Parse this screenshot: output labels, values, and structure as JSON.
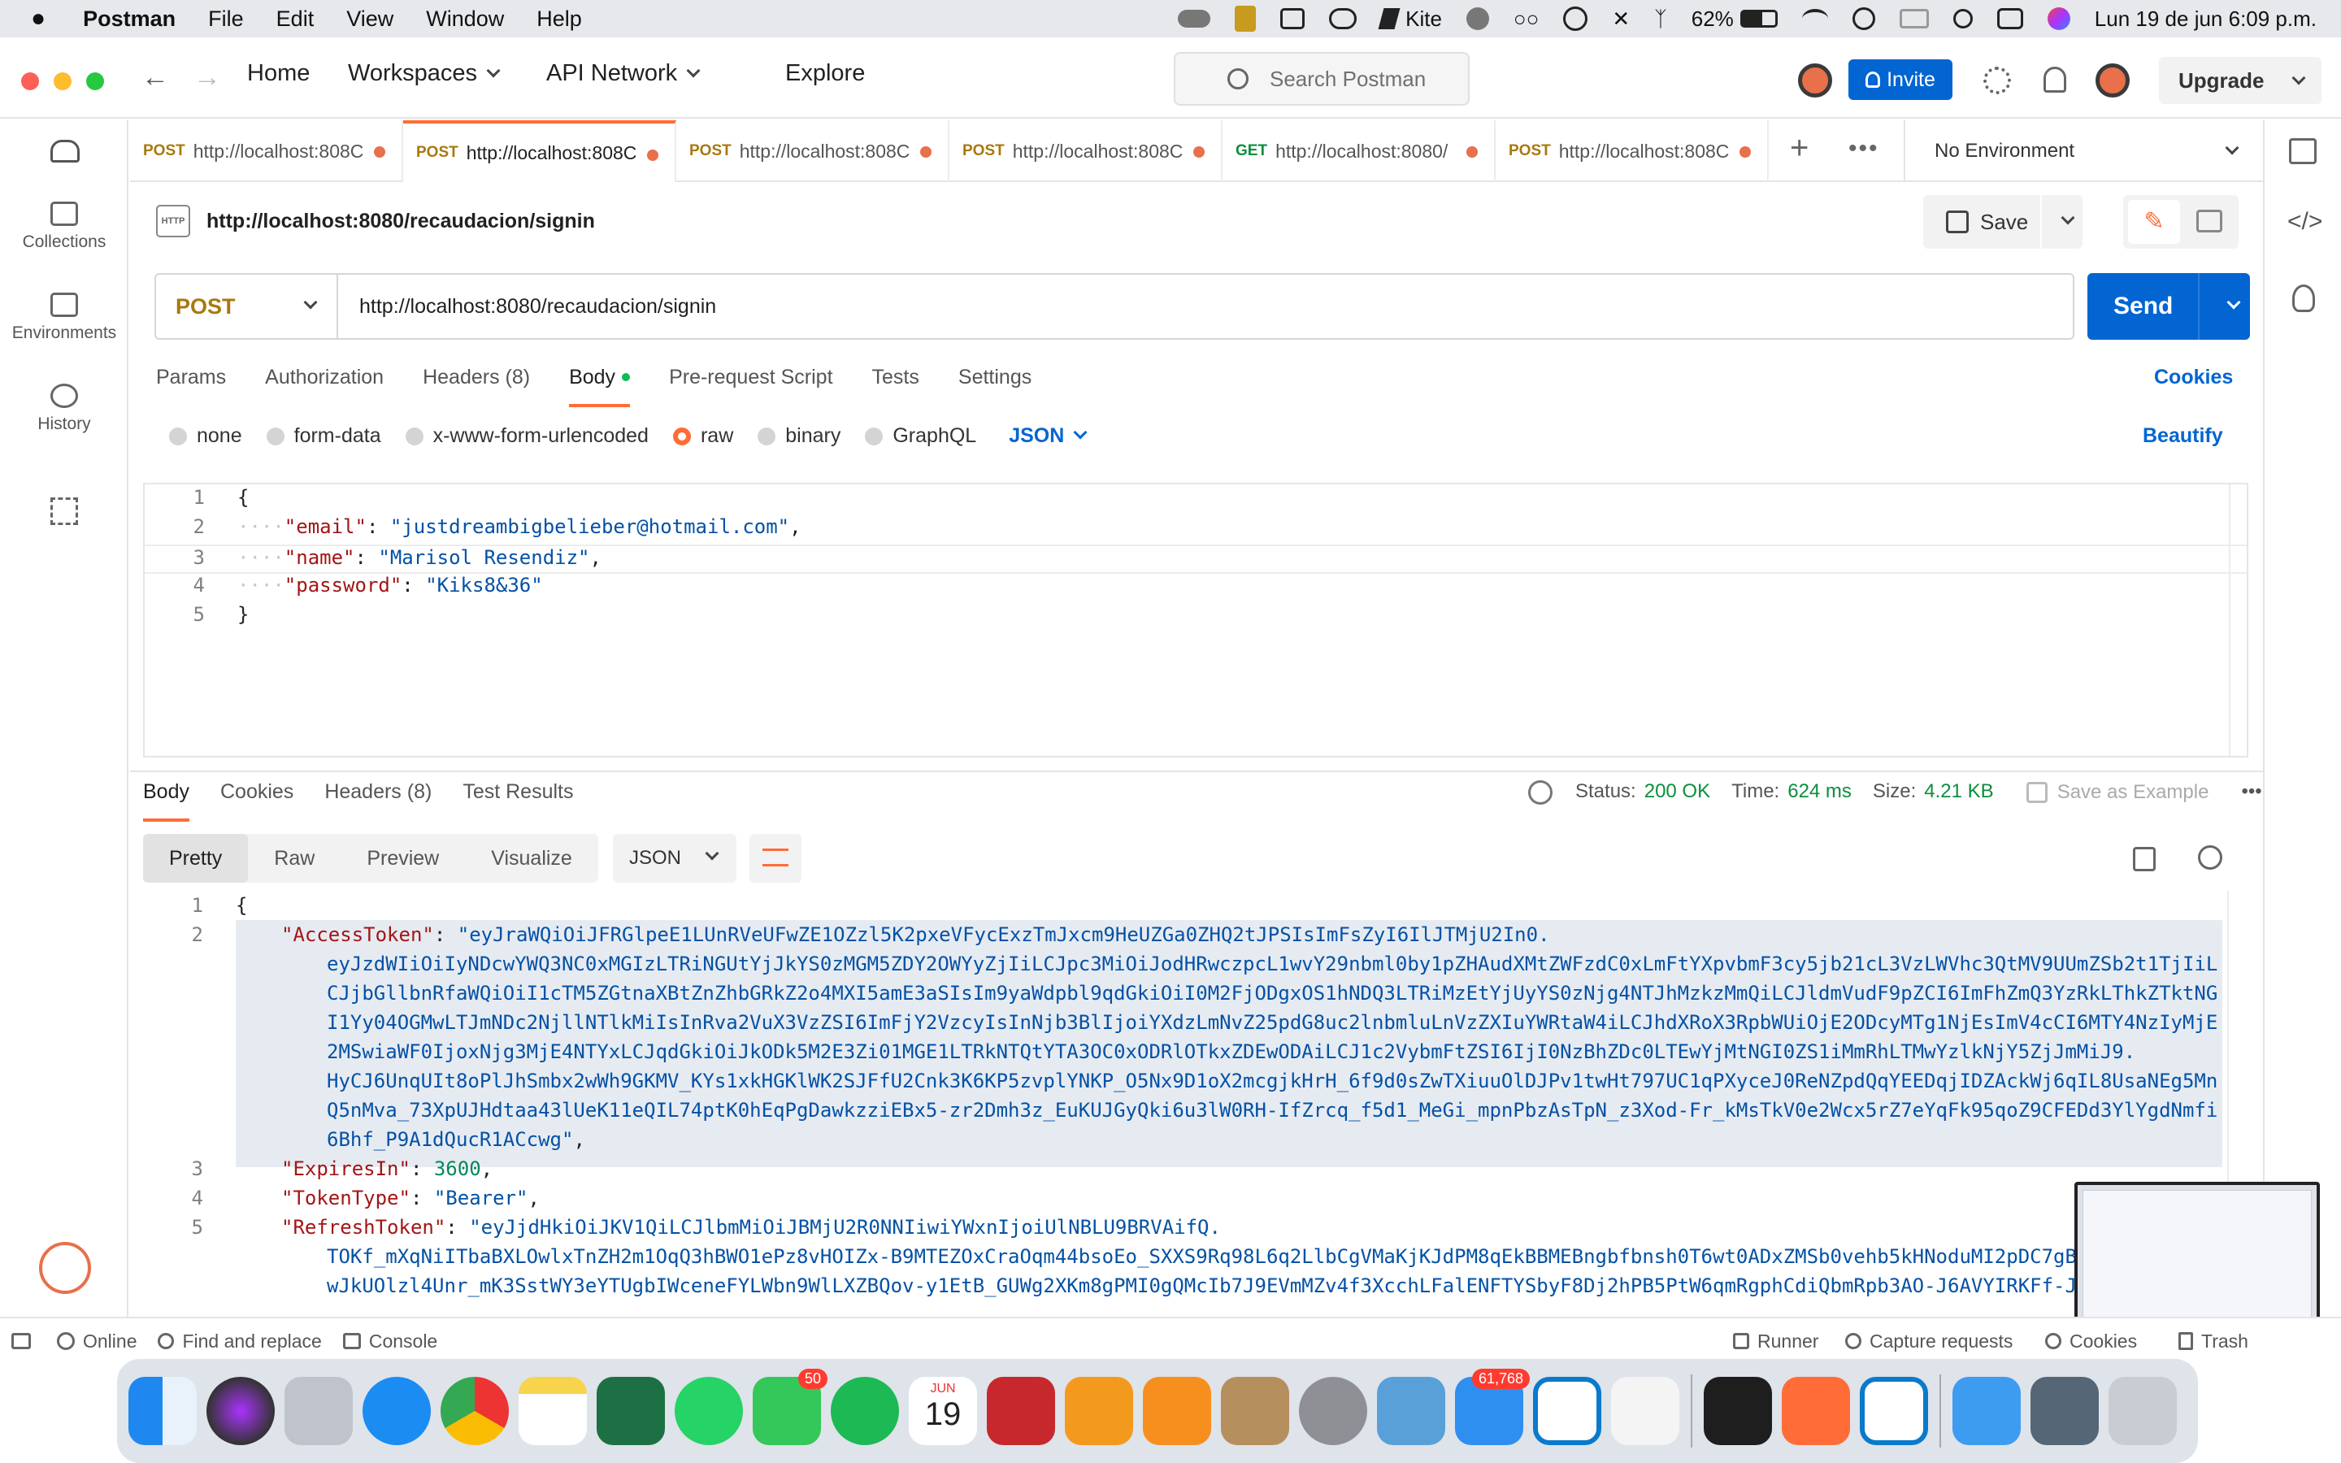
{
  "menubar": {
    "app_name": "Postman",
    "menus": [
      "File",
      "Edit",
      "View",
      "Window",
      "Help"
    ],
    "kite_label": "Kite",
    "battery": "62%",
    "clock": "Lun 19 de jun  6:09 p.m."
  },
  "header": {
    "nav": [
      "Home",
      "Workspaces",
      "API Network",
      "Explore"
    ],
    "search_placeholder": "Search Postman",
    "invite_label": "Invite",
    "upgrade_label": "Upgrade"
  },
  "sidebar": {
    "items": [
      {
        "label": "Collections"
      },
      {
        "label": "Environments"
      },
      {
        "label": "History"
      }
    ]
  },
  "tabs": [
    {
      "method": "POST",
      "url": "http://localhost:808C",
      "active": false
    },
    {
      "method": "POST",
      "url": "http://localhost:808C",
      "active": true
    },
    {
      "method": "POST",
      "url": "http://localhost:808C",
      "active": false
    },
    {
      "method": "POST",
      "url": "http://localhost:808C",
      "active": false
    },
    {
      "method": "GET",
      "url": "http://localhost:8080/",
      "active": false
    },
    {
      "method": "POST",
      "url": "http://localhost:808C",
      "active": false
    }
  ],
  "environment": "No Environment",
  "request": {
    "title": "http://localhost:8080/recaudacion/signin",
    "save_label": "Save",
    "method": "POST",
    "url": "http://localhost:8080/recaudacion/signin",
    "send_label": "Send",
    "subtabs": [
      "Params",
      "Authorization",
      "Headers (8)",
      "Body",
      "Pre-request Script",
      "Tests",
      "Settings"
    ],
    "cookies_label": "Cookies",
    "body_options": [
      "none",
      "form-data",
      "x-www-form-urlencoded",
      "raw",
      "binary",
      "GraphQL"
    ],
    "body_format": "JSON",
    "beautify_label": "Beautify",
    "body_lines": [
      {
        "n": "1",
        "text": "{"
      },
      {
        "n": "2",
        "key": "\"email\"",
        "value": "\"justdreambigbelieber@hotmail.com\"",
        "tail": ","
      },
      {
        "n": "3",
        "key": "\"name\"",
        "value": "\"Marisol Resendiz\"",
        "tail": ","
      },
      {
        "n": "4",
        "key": "\"password\"",
        "value": "\"Kiks8&36\"",
        "tail": ""
      },
      {
        "n": "5",
        "text": "}"
      }
    ]
  },
  "response": {
    "tabs": [
      "Body",
      "Cookies",
      "Headers (8)",
      "Test Results"
    ],
    "status_label": "Status:",
    "status_value": "200 OK",
    "time_label": "Time:",
    "time_value": "624 ms",
    "size_label": "Size:",
    "size_value": "4.21 KB",
    "save_example_label": "Save as Example",
    "views": [
      "Pretty",
      "Raw",
      "Preview",
      "Visualize"
    ],
    "format": "JSON",
    "line_numbers": [
      "1",
      "2",
      "3",
      "4",
      "5"
    ],
    "open_brace": "{",
    "access_token_key": "\"AccessToken\"",
    "access_token_lines": [
      "\"eyJraWQiOiJFRGlpeE1LUnRVeUFwZE1OZzl5K2pxeVFycExzTmJxcm9HeUZGa0ZHQ2tJPSIsImFsZyI6IlJTMjU2In0.",
      "eyJzdWIiOiIyNDcwYWQ3NC0xMGIzLTRiNGUtYjJkYS0zMGM5ZDY2OWYyZjIiLCJpc3MiOiJodHRwczpcL1wvY29nbml0by1pZHAudXMtZWFzdC0xLmFtYXpvbmF3cy5jb21cL3VzLWVhc3QtMV9UUmZSb2t1TjIiL",
      "CJjbGllbnRfaWQiOiI1cTM5ZGtnaXBtZnZhbGRkZ2o4MXI5amE3aSIsIm9yaWdpbl9qdGkiOiI0M2FjODgxOS1hNDQ3LTRiMzEtYjUyYS0zNjg4NTJhMzkzMmQiLCJldmVudF9pZCI6ImFhZmQ3YzRkLThkZTktNG",
      "I1Yy04OGMwLTJmNDc2NjllNTlkMiIsInRva2VuX3VzZSI6ImFjY2VzcyIsInNjb3BlIjoiYXdzLmNvZ25pdG8uc2lnbmluLnVzZXIuYWRtaW4iLCJhdXRoX3RpbWUiOjE2ODcyMTg1NjEsImV4cCI6MTY4NzIyMjE",
      "2MSwiaWF0IjoxNjg3MjE4NTYxLCJqdGkiOiJkODk5M2E3Zi01MGE1LTRkNTQtYTA3OC0xODRlOTkxZDEwODAiLCJ1c2VybmFtZSI6IjI0NzBhZDc0LTEwYjMtNGI0ZS1iMmRhLTMwYzlkNjY5ZjJmMiJ9.",
      "HyCJ6UnqUIt8oPlJhSmbx2wWh9GKMV_KYs1xkHGKlWK2SJFfU2Cnk3K6KP5zvplYNKP_O5Nx9D1oX2mcgjkHrH_6f9d0sZwTXiuuOlDJPv1twHt797UC1qPXyceJ0ReNZpdQqYEEDqjIDZAckWj6qIL8UsaNEg5Mn",
      "Q5nMva_73XpUJHdtaa43lUeK11eQIL74ptK0hEqPgDawkzziEBx5-zr2Dmh3z_EuKUJGyQki6u3lW0RH-IfZrcq_f5d1_MeGi_mpnPbzAsTpN_z3Xod-Fr_kMsTkV0e2Wcx5rZ7eYqFk95qoZ9CFEDd3YlYgdNmfi",
      "6Bhf_P9A1dQucR1ACcwg\""
    ],
    "expires_key": "\"ExpiresIn\"",
    "expires_value": "3600",
    "token_type_key": "\"TokenType\"",
    "token_type_value": "\"Bearer\"",
    "refresh_key": "\"RefreshToken\"",
    "refresh_lines": [
      "\"eyJjdHkiOiJKV1QiLCJlbmMiOiJBMjU2R0NNIiwiYWxnIjoiUlNBLU9BRVAifQ.",
      "TOKf_mXqNiITbaBXLOwlxTnZH2m1OqQ3hBWO1ePz8vHOIZx-B9MTEZOxCraOqm44bsoEo_SXXS9Rq98L6q2LlbCgVMaKjKJdPM8qEkBBMEBngbfbnsh0T6wt0ADxZMSb0vehb5kHNoduMI2pDC7gB",
      "wJkUOlzl4Unr_mK3SstWY3eYTUgbIWceneFYLWbn9WlLXZBQov-y1EtB_GUWg2XKm8gPMI0gQMcIb7J9EVmMZv4f3XcchLFalENFTYSbyF8Dj2hPB5PtW6qmRgphCdiQbmRpb3AO-J6AVYIRKFf-J"
    ]
  },
  "statusbar": {
    "online_label": "Online",
    "find_label": "Find and replace",
    "console_label": "Console",
    "runner_label": "Runner",
    "capture_label": "Capture requests",
    "cookies_label": "Cookies",
    "trash_label": "Trash"
  },
  "dock": {
    "calendar_month": "JUN",
    "calendar_day": "19",
    "messages_badge": "50",
    "mail_badge": "61,768"
  },
  "colors": {
    "accent": "#ff6c37",
    "primary": "#0265d2",
    "method_post": "#a9780d",
    "method_get": "#0a8f3d",
    "status_ok": "#0a8f3d"
  }
}
